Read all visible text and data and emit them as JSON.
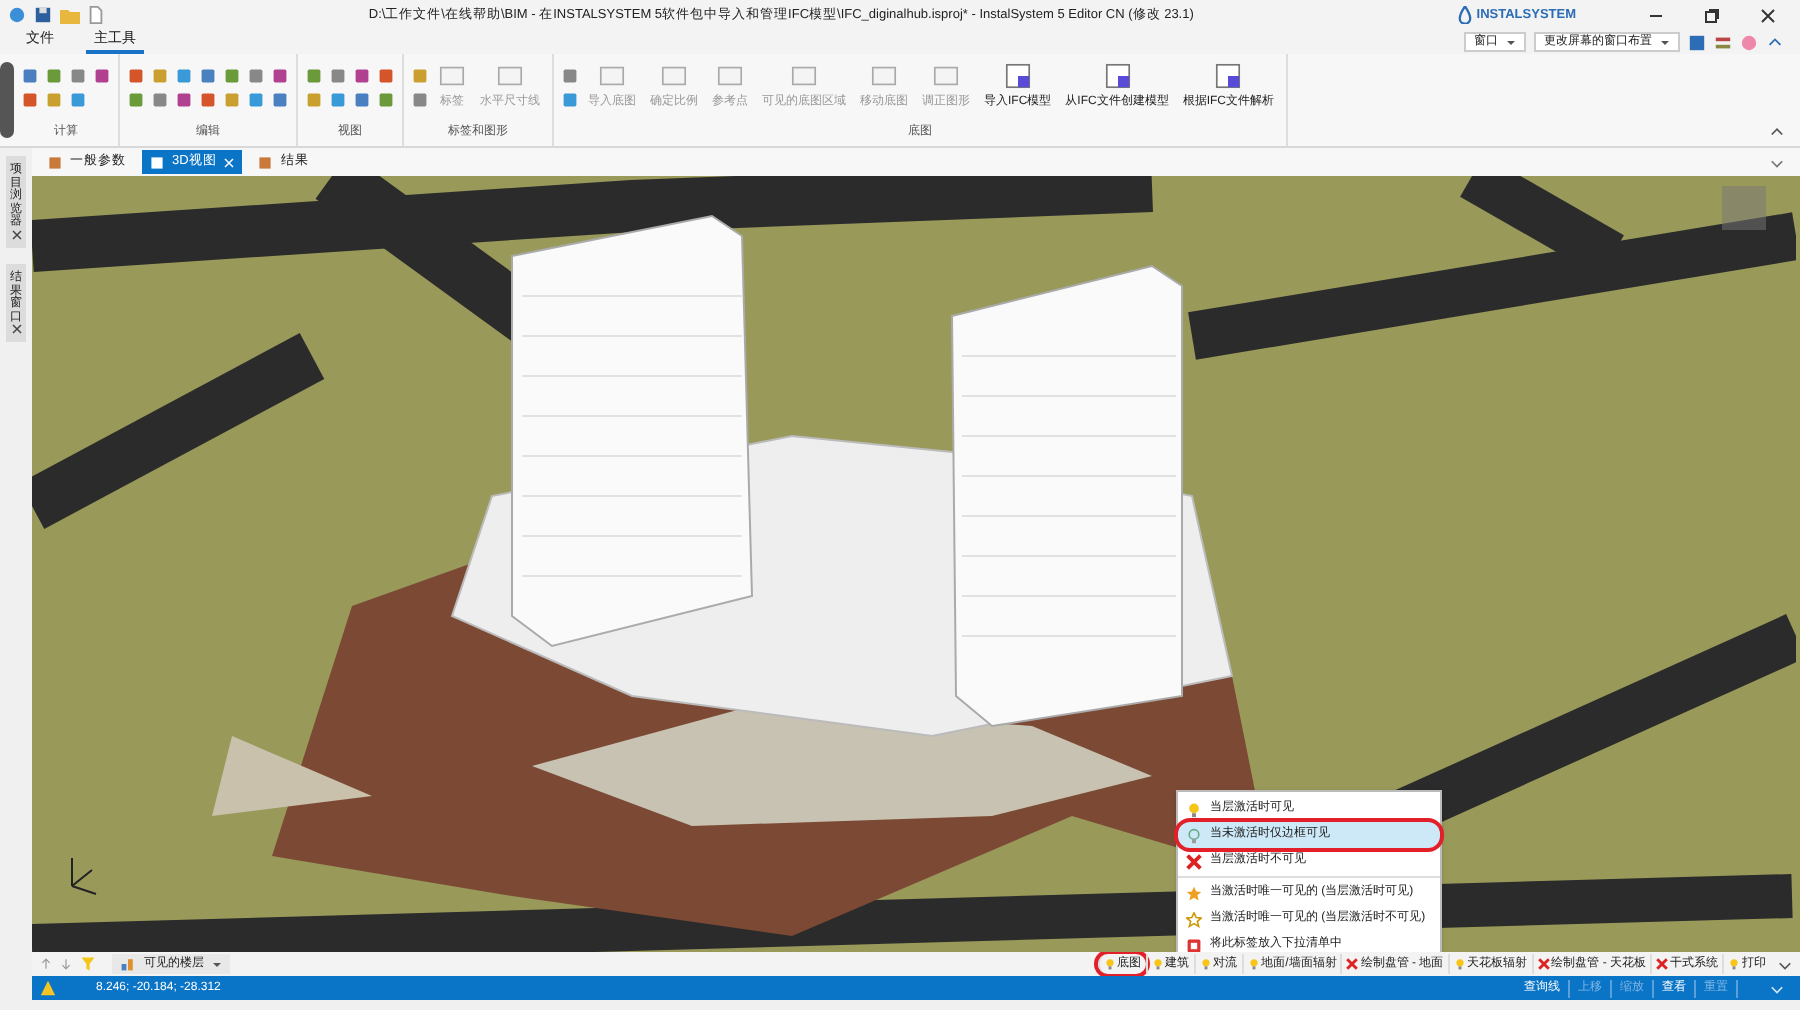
{
  "title_bar": {
    "title": "D:\\工作文件\\在线帮助\\BIM - 在INSTALSYSTEM 5软件包中导入和管理IFC模型\\IFC_diginalhub.isproj* - InstalSystem 5 Editor CN (修改 23.1)",
    "brand": "INSTALSYSTEM"
  },
  "menu_tabs": [
    {
      "label": "文件",
      "selected": false
    },
    {
      "label": "主工具",
      "selected": true
    }
  ],
  "window_tools": {
    "window_dropdown": "窗口",
    "layout_dropdown": "更改屏幕的窗口布置"
  },
  "ribbon_groups": [
    {
      "label": "计算"
    },
    {
      "label": "编辑"
    },
    {
      "label": "视图"
    },
    {
      "label": "标签和图形",
      "buttons": [
        {
          "label": "标签",
          "disabled": true
        },
        {
          "label": "水平尺寸线",
          "disabled": true
        }
      ]
    },
    {
      "label": "底图",
      "buttons": [
        {
          "label": "导入底图",
          "disabled": true
        },
        {
          "label": "确定比例",
          "disabled": true
        },
        {
          "label": "参考点",
          "disabled": true
        },
        {
          "label": "可见的底图区域",
          "disabled": true
        },
        {
          "label": "移动底图",
          "disabled": true
        },
        {
          "label": "调正图形",
          "disabled": true
        },
        {
          "label": "导入IFC模型",
          "disabled": false
        },
        {
          "label": "从IFC文件创建模型",
          "disabled": false
        },
        {
          "label": "根据IFC文件解析",
          "disabled": false
        }
      ]
    }
  ],
  "side_tabs": [
    {
      "label": "项目浏览器"
    },
    {
      "label": "结果窗口"
    }
  ],
  "doc_tabs": [
    {
      "label": "一般参数",
      "selected": false
    },
    {
      "label": "3D视图",
      "selected": true
    },
    {
      "label": "结果",
      "selected": false
    }
  ],
  "context_menu": [
    {
      "label": "当层激活时可见",
      "kind": "visible",
      "selected": false,
      "circled": false
    },
    {
      "label": "当未激活时仅边框可见",
      "kind": "outline",
      "selected": true,
      "circled": true
    },
    {
      "label": "当层激活时不可见",
      "kind": "hidden",
      "selected": false,
      "circled": false
    },
    {
      "label": "当激活时唯一可见的 (当层激活时可见)",
      "kind": "star",
      "selected": false,
      "circled": false
    },
    {
      "label": "当激活时唯一可见的 (当层激活时不可见)",
      "kind": "star_outline",
      "selected": false,
      "circled": false
    },
    {
      "label": "将此标签放入下拉清单中",
      "kind": "pin",
      "selected": false,
      "circled": false
    }
  ],
  "layer_bar": {
    "floors_dropdown": "可见的楼层",
    "layers": [
      {
        "label": "底图",
        "kind": "visible",
        "circled": true
      },
      {
        "label": "建筑",
        "kind": "visible",
        "circled": false
      },
      {
        "label": "对流",
        "kind": "visible",
        "circled": false
      },
      {
        "label": "地面/墙面辐射",
        "kind": "visible",
        "circled": false
      },
      {
        "label": "绘制盘管 - 地面",
        "kind": "hidden",
        "circled": false
      },
      {
        "label": "天花板辐射",
        "kind": "visible",
        "circled": false
      },
      {
        "label": "绘制盘管 - 天花板",
        "kind": "hidden",
        "circled": false
      },
      {
        "label": "干式系统",
        "kind": "hidden",
        "circled": false
      },
      {
        "label": "打印",
        "kind": "visible",
        "circled": false
      }
    ]
  },
  "status_bar": {
    "coordinates": "8.246; -20.184; -28.312",
    "buttons": [
      {
        "label": "查询线",
        "disabled": false
      },
      {
        "label": "上移",
        "disabled": true
      },
      {
        "label": "缩放",
        "disabled": true
      },
      {
        "label": "查看",
        "disabled": false
      },
      {
        "label": "重置",
        "disabled": true
      }
    ]
  }
}
